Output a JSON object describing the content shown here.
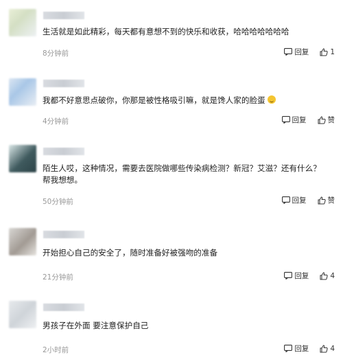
{
  "comments": [
    {
      "text": "生活就是如此精彩，每天都有意想不到的快乐和收获，哈哈哈哈哈哈哈",
      "time": "8分钟前",
      "reply_label": "回复",
      "like_count": "1"
    },
    {
      "text": "我都不好意思点破你，你那是被性格吸引嘛，就是馋人家的脸蛋",
      "time": "4分钟前",
      "reply_label": "回复",
      "like_label": "赞"
    },
    {
      "text": "陌生人哎，这种情况，需要去医院做哪些传染病检测？新冠？艾滋？还有什么？帮我想想。",
      "time": "50分钟前",
      "reply_label": "回复",
      "like_label": "赞"
    },
    {
      "text": "开始担心自己的安全了，随时准备好被强吻的准备",
      "time": "21分钟前",
      "reply_label": "回复",
      "like_count": "4"
    },
    {
      "text": "男孩子在外面 要注意保护自己",
      "time": "2小时前",
      "reply_label": "回复",
      "like_count": "4"
    }
  ]
}
